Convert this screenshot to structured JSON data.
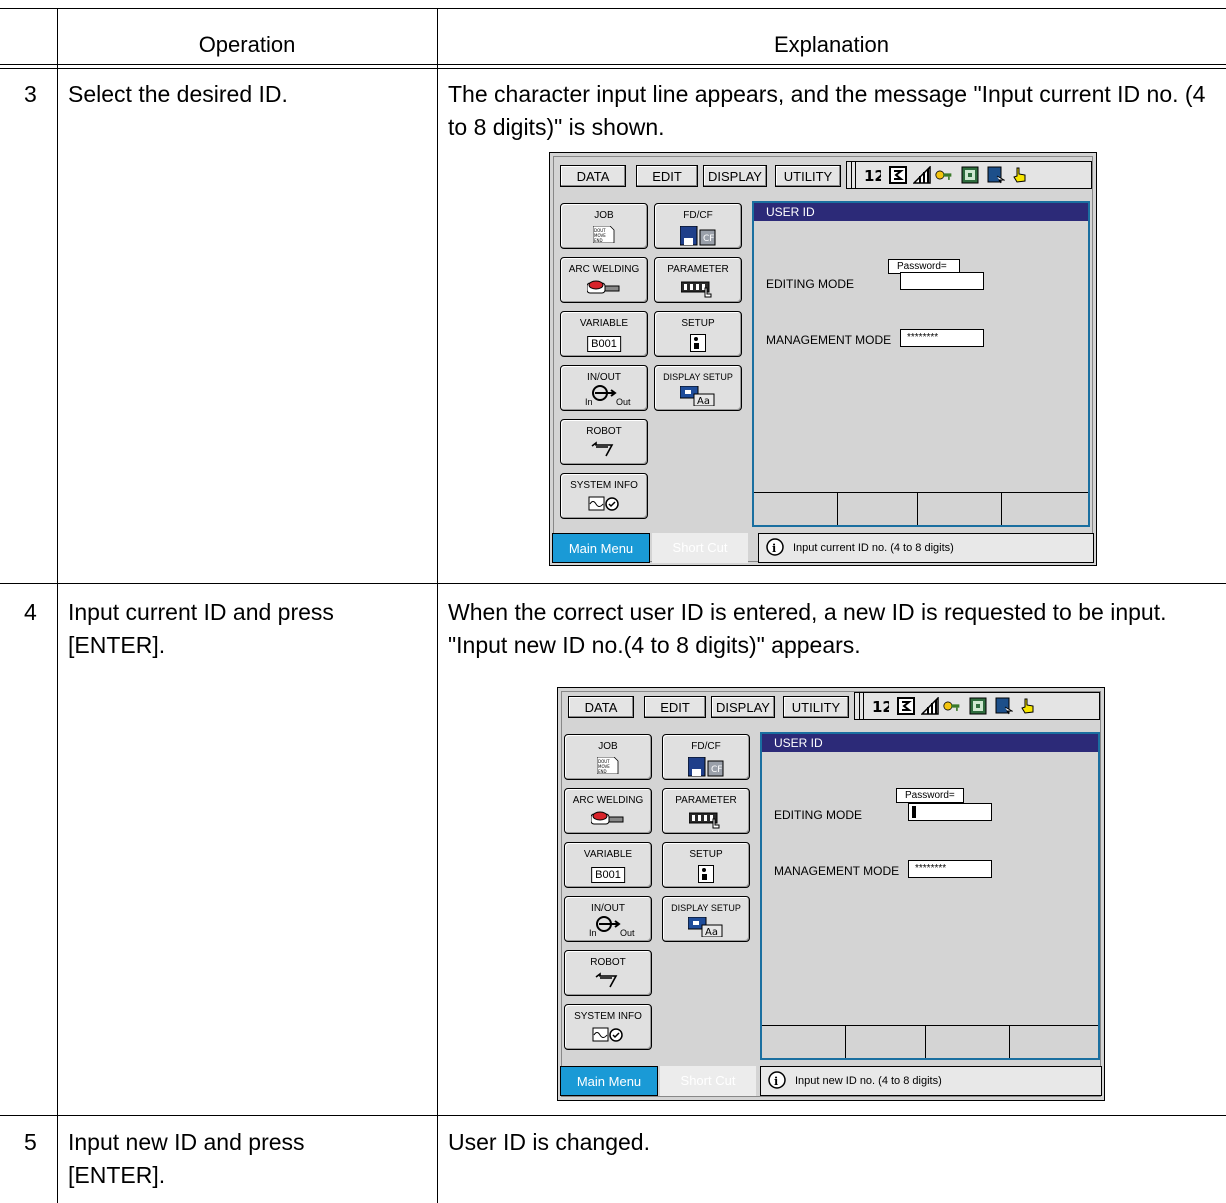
{
  "table": {
    "header_operation": "Operation",
    "header_explanation": "Explanation",
    "rows": [
      {
        "step": "3",
        "operation": "Select the desired ID.",
        "explanation": "The character input line appears, and the message \"Input current ID no. (4 to 8 digits)\" is shown."
      },
      {
        "step": "4",
        "operation": "Input current ID and press [ENTER].",
        "explanation": "When the correct user ID is entered, a new ID is requested to be input. \"Input new ID no.(4 to 8 digits)\" appears."
      },
      {
        "step": "5",
        "operation": "Input new ID and press [ENTER].",
        "explanation": "User ID is changed."
      }
    ]
  },
  "screens": [
    {
      "topbar": {
        "data": "DATA",
        "edit": "EDIT",
        "display": "DISPLAY",
        "utility": "UTILITY"
      },
      "menu": {
        "job": "JOB",
        "job_icon_text": "DOUT MOVE END",
        "fdcf": "FD/CF",
        "fdcf_icon_text": "CF",
        "arc": "ARC WELDING",
        "parameter": "PARAMETER",
        "variable": "VARIABLE",
        "variable_icon_text": "B001",
        "setup": "SETUP",
        "inout": "IN/OUT",
        "in": "In",
        "out": "Out",
        "display_setup": "DISPLAY SETUP",
        "display_setup_icon_text": "Aa",
        "robot": "ROBOT",
        "system_info": "SYSTEM INFO"
      },
      "panel": {
        "title": "USER ID",
        "password_prompt": "Password=",
        "editing_mode": "EDITING MODE",
        "management_mode": "MANAGEMENT MODE",
        "management_value": "********"
      },
      "main_menu": "Main Menu",
      "short_cut": "Short Cut",
      "message": "Input current ID no. (4 to 8 digits)"
    },
    {
      "topbar": {
        "data": "DATA",
        "edit": "EDIT",
        "display": "DISPLAY",
        "utility": "UTILITY"
      },
      "menu": {
        "job": "JOB",
        "job_icon_text": "DOUT MOVE END",
        "fdcf": "FD/CF",
        "fdcf_icon_text": "CF",
        "arc": "ARC WELDING",
        "parameter": "PARAMETER",
        "variable": "VARIABLE",
        "variable_icon_text": "B001",
        "setup": "SETUP",
        "inout": "IN/OUT",
        "in": "In",
        "out": "Out",
        "display_setup": "DISPLAY SETUP",
        "display_setup_icon_text": "Aa",
        "robot": "ROBOT",
        "system_info": "SYSTEM INFO"
      },
      "panel": {
        "title": "USER ID",
        "password_prompt": "Password=",
        "editing_mode": "EDITING MODE",
        "management_mode": "MANAGEMENT MODE",
        "management_value": "********"
      },
      "main_menu": "Main Menu",
      "short_cut": "Short Cut",
      "message": "Input new ID no. (4 to 8 digits)"
    }
  ],
  "colors": {
    "panel_title": "#2c2a78",
    "panel_border": "#1a6fa0",
    "main_menu": "#1a9ad6"
  }
}
